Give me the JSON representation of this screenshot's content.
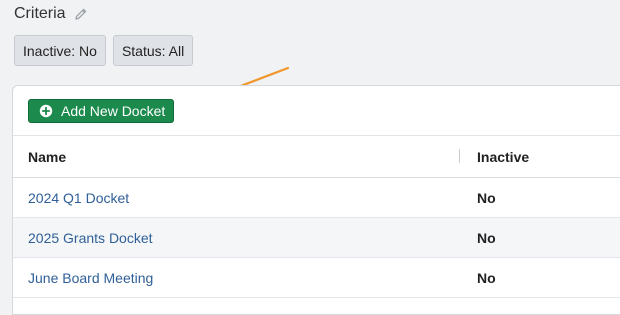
{
  "criteria": {
    "title": "Criteria",
    "edit_icon": "pencil-icon"
  },
  "filters": [
    {
      "label": "Inactive: No"
    },
    {
      "label": "Status: All"
    }
  ],
  "toolbar": {
    "add_label": "Add New Docket",
    "add_icon": "plus-circle-icon",
    "add_color": "#1b8a4c"
  },
  "table": {
    "columns": [
      "Name",
      "Inactive"
    ],
    "rows": [
      {
        "name": "2024 Q1 Docket",
        "inactive": "No"
      },
      {
        "name": "2025 Grants Docket",
        "inactive": "No"
      },
      {
        "name": "June Board Meeting",
        "inactive": "No"
      }
    ]
  },
  "annotation": {
    "arrow_color": "#f0962c"
  }
}
